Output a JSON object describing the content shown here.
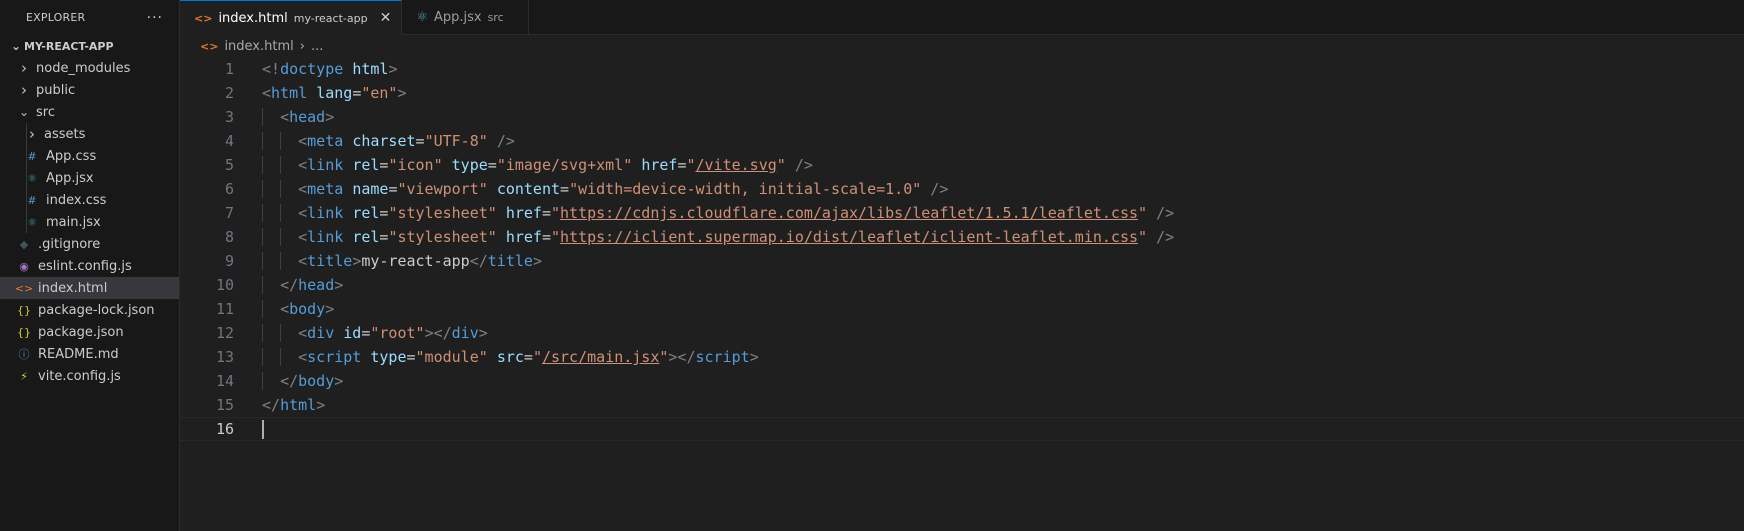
{
  "explorer": {
    "title": "EXPLORER",
    "more": "···",
    "project": "MY-REACT-APP",
    "items": [
      {
        "label": "node_modules",
        "kind": "folder",
        "state": "closed",
        "depth": 0,
        "icon": "chevron-right-icon"
      },
      {
        "label": "public",
        "kind": "folder",
        "state": "closed",
        "depth": 0,
        "icon": "chevron-right-icon"
      },
      {
        "label": "src",
        "kind": "folder",
        "state": "open",
        "depth": 0,
        "icon": "chevron-down-icon"
      },
      {
        "label": "assets",
        "kind": "folder",
        "state": "closed",
        "depth": 1,
        "icon": "chevron-right-icon"
      },
      {
        "label": "App.css",
        "kind": "file",
        "depth": 1,
        "icon": "css-file-icon",
        "glyph": "#",
        "color": "#519aba"
      },
      {
        "label": "App.jsx",
        "kind": "file",
        "depth": 1,
        "icon": "react-file-icon",
        "glyph": "⚛",
        "color": "#519aba"
      },
      {
        "label": "index.css",
        "kind": "file",
        "depth": 1,
        "icon": "css-file-icon",
        "glyph": "#",
        "color": "#519aba"
      },
      {
        "label": "main.jsx",
        "kind": "file",
        "depth": 1,
        "icon": "react-file-icon",
        "glyph": "⚛",
        "color": "#519aba"
      },
      {
        "label": ".gitignore",
        "kind": "file",
        "depth": 0,
        "icon": "git-file-icon",
        "glyph": "◆",
        "color": "#41535b"
      },
      {
        "label": "eslint.config.js",
        "kind": "file",
        "depth": 0,
        "icon": "eslint-file-icon",
        "glyph": "◉",
        "color": "#a074c4"
      },
      {
        "label": "index.html",
        "kind": "file",
        "depth": 0,
        "icon": "html-file-icon",
        "glyph": "<>",
        "color": "#e37933",
        "selected": true
      },
      {
        "label": "package-lock.json",
        "kind": "file",
        "depth": 0,
        "icon": "json-file-icon",
        "glyph": "{}",
        "color": "#cbcb41"
      },
      {
        "label": "package.json",
        "kind": "file",
        "depth": 0,
        "icon": "json-file-icon",
        "glyph": "{}",
        "color": "#cbcb41"
      },
      {
        "label": "README.md",
        "kind": "file",
        "depth": 0,
        "icon": "info-file-icon",
        "glyph": "ⓘ",
        "color": "#519aba"
      },
      {
        "label": "vite.config.js",
        "kind": "file",
        "depth": 0,
        "icon": "vite-file-icon",
        "glyph": "⚡",
        "color": "#cbcb41"
      }
    ]
  },
  "tabs": [
    {
      "label": "index.html",
      "sub": "my-react-app",
      "active": true,
      "icon": "html-file-icon",
      "close": "✕"
    },
    {
      "label": "App.jsx",
      "sub": "src",
      "active": false,
      "icon": "react-file-icon"
    }
  ],
  "breadcrumb": {
    "file": "index.html",
    "sep": "›",
    "rest": "..."
  },
  "code": {
    "current_line": 16,
    "lines": [
      [
        [
          "punc",
          "<!"
        ],
        [
          "tag",
          "doctype"
        ],
        [
          "txt",
          " "
        ],
        [
          "attr",
          "html"
        ],
        [
          "punc",
          ">"
        ]
      ],
      [
        [
          "punc",
          "<"
        ],
        [
          "tag",
          "html"
        ],
        [
          "txt",
          " "
        ],
        [
          "attr",
          "lang"
        ],
        [
          "txt",
          "="
        ],
        [
          "str",
          "\"en\""
        ],
        [
          "punc",
          ">"
        ]
      ],
      [
        [
          "txt",
          "  "
        ],
        [
          "punc",
          "<"
        ],
        [
          "tag",
          "head"
        ],
        [
          "punc",
          ">"
        ]
      ],
      [
        [
          "txt",
          "    "
        ],
        [
          "punc",
          "<"
        ],
        [
          "tag",
          "meta"
        ],
        [
          "txt",
          " "
        ],
        [
          "attr",
          "charset"
        ],
        [
          "txt",
          "="
        ],
        [
          "str",
          "\"UTF-8\""
        ],
        [
          "txt",
          " "
        ],
        [
          "punc",
          "/>"
        ]
      ],
      [
        [
          "txt",
          "    "
        ],
        [
          "punc",
          "<"
        ],
        [
          "tag",
          "link"
        ],
        [
          "txt",
          " "
        ],
        [
          "attr",
          "rel"
        ],
        [
          "txt",
          "="
        ],
        [
          "str",
          "\"icon\""
        ],
        [
          "txt",
          " "
        ],
        [
          "attr",
          "type"
        ],
        [
          "txt",
          "="
        ],
        [
          "str",
          "\"image/svg+xml\""
        ],
        [
          "txt",
          " "
        ],
        [
          "attr",
          "href"
        ],
        [
          "txt",
          "="
        ],
        [
          "str",
          "\""
        ],
        [
          "link",
          "/vite.svg"
        ],
        [
          "str",
          "\""
        ],
        [
          "txt",
          " "
        ],
        [
          "punc",
          "/>"
        ]
      ],
      [
        [
          "txt",
          "    "
        ],
        [
          "punc",
          "<"
        ],
        [
          "tag",
          "meta"
        ],
        [
          "txt",
          " "
        ],
        [
          "attr",
          "name"
        ],
        [
          "txt",
          "="
        ],
        [
          "str",
          "\"viewport\""
        ],
        [
          "txt",
          " "
        ],
        [
          "attr",
          "content"
        ],
        [
          "txt",
          "="
        ],
        [
          "str",
          "\"width=device-width, initial-scale=1.0\""
        ],
        [
          "txt",
          " "
        ],
        [
          "punc",
          "/>"
        ]
      ],
      [
        [
          "txt",
          "    "
        ],
        [
          "punc",
          "<"
        ],
        [
          "tag",
          "link"
        ],
        [
          "txt",
          " "
        ],
        [
          "attr",
          "rel"
        ],
        [
          "txt",
          "="
        ],
        [
          "str",
          "\"stylesheet\""
        ],
        [
          "txt",
          " "
        ],
        [
          "attr",
          "href"
        ],
        [
          "txt",
          "="
        ],
        [
          "str",
          "\""
        ],
        [
          "link",
          "https://cdnjs.cloudflare.com/ajax/libs/leaflet/1.5.1/leaflet.css"
        ],
        [
          "str",
          "\""
        ],
        [
          "txt",
          " "
        ],
        [
          "punc",
          "/>"
        ]
      ],
      [
        [
          "txt",
          "    "
        ],
        [
          "punc",
          "<"
        ],
        [
          "tag",
          "link"
        ],
        [
          "txt",
          " "
        ],
        [
          "attr",
          "rel"
        ],
        [
          "txt",
          "="
        ],
        [
          "str",
          "\"stylesheet\""
        ],
        [
          "txt",
          " "
        ],
        [
          "attr",
          "href"
        ],
        [
          "txt",
          "="
        ],
        [
          "str",
          "\""
        ],
        [
          "link",
          "https://iclient.supermap.io/dist/leaflet/iclient-leaflet.min.css"
        ],
        [
          "str",
          "\""
        ],
        [
          "txt",
          " "
        ],
        [
          "punc",
          "/>"
        ]
      ],
      [
        [
          "txt",
          "    "
        ],
        [
          "punc",
          "<"
        ],
        [
          "tag",
          "title"
        ],
        [
          "punc",
          ">"
        ],
        [
          "txt",
          "my-react-app"
        ],
        [
          "punc",
          "</"
        ],
        [
          "tag",
          "title"
        ],
        [
          "punc",
          ">"
        ]
      ],
      [
        [
          "txt",
          "  "
        ],
        [
          "punc",
          "</"
        ],
        [
          "tag",
          "head"
        ],
        [
          "punc",
          ">"
        ]
      ],
      [
        [
          "txt",
          "  "
        ],
        [
          "punc",
          "<"
        ],
        [
          "tag",
          "body"
        ],
        [
          "punc",
          ">"
        ]
      ],
      [
        [
          "txt",
          "    "
        ],
        [
          "punc",
          "<"
        ],
        [
          "tag",
          "div"
        ],
        [
          "txt",
          " "
        ],
        [
          "attr",
          "id"
        ],
        [
          "txt",
          "="
        ],
        [
          "str",
          "\"root\""
        ],
        [
          "punc",
          "></"
        ],
        [
          "tag",
          "div"
        ],
        [
          "punc",
          ">"
        ]
      ],
      [
        [
          "txt",
          "    "
        ],
        [
          "punc",
          "<"
        ],
        [
          "tag",
          "script"
        ],
        [
          "txt",
          " "
        ],
        [
          "attr",
          "type"
        ],
        [
          "txt",
          "="
        ],
        [
          "str",
          "\"module\""
        ],
        [
          "txt",
          " "
        ],
        [
          "attr",
          "src"
        ],
        [
          "txt",
          "="
        ],
        [
          "str",
          "\""
        ],
        [
          "link",
          "/src/main.jsx"
        ],
        [
          "str",
          "\""
        ],
        [
          "punc",
          "></"
        ],
        [
          "tag",
          "script"
        ],
        [
          "punc",
          ">"
        ]
      ],
      [
        [
          "txt",
          "  "
        ],
        [
          "punc",
          "</"
        ],
        [
          "tag",
          "body"
        ],
        [
          "punc",
          ">"
        ]
      ],
      [
        [
          "punc",
          "</"
        ],
        [
          "tag",
          "html"
        ],
        [
          "punc",
          ">"
        ]
      ],
      []
    ]
  }
}
